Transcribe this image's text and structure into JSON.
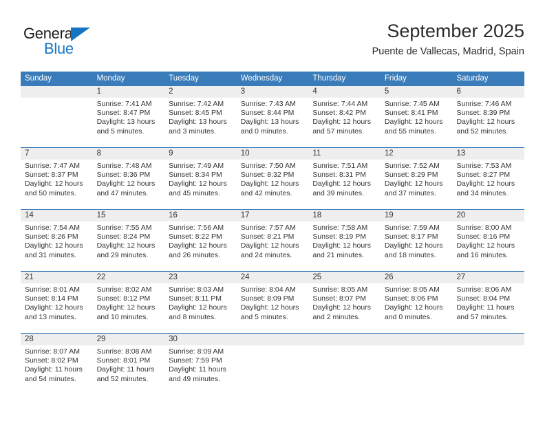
{
  "brand": {
    "name_part1": "General",
    "name_part2": "Blue",
    "triangle_icon": "triangle-icon",
    "accent_color": "#1676c4"
  },
  "header": {
    "title": "September 2025",
    "subtitle": "Puente de Vallecas, Madrid, Spain"
  },
  "calendar": {
    "header_bg_color": "#3a7cba",
    "day_band_color": "#eeeeee",
    "weekday_headers": [
      "Sunday",
      "Monday",
      "Tuesday",
      "Wednesday",
      "Thursday",
      "Friday",
      "Saturday"
    ],
    "weeks": [
      [
        {
          "day": "",
          "sunrise": "",
          "sunset": "",
          "daylight_line1": "",
          "daylight_line2": ""
        },
        {
          "day": "1",
          "sunrise": "Sunrise: 7:41 AM",
          "sunset": "Sunset: 8:47 PM",
          "daylight_line1": "Daylight: 13 hours",
          "daylight_line2": "and 5 minutes."
        },
        {
          "day": "2",
          "sunrise": "Sunrise: 7:42 AM",
          "sunset": "Sunset: 8:45 PM",
          "daylight_line1": "Daylight: 13 hours",
          "daylight_line2": "and 3 minutes."
        },
        {
          "day": "3",
          "sunrise": "Sunrise: 7:43 AM",
          "sunset": "Sunset: 8:44 PM",
          "daylight_line1": "Daylight: 13 hours",
          "daylight_line2": "and 0 minutes."
        },
        {
          "day": "4",
          "sunrise": "Sunrise: 7:44 AM",
          "sunset": "Sunset: 8:42 PM",
          "daylight_line1": "Daylight: 12 hours",
          "daylight_line2": "and 57 minutes."
        },
        {
          "day": "5",
          "sunrise": "Sunrise: 7:45 AM",
          "sunset": "Sunset: 8:41 PM",
          "daylight_line1": "Daylight: 12 hours",
          "daylight_line2": "and 55 minutes."
        },
        {
          "day": "6",
          "sunrise": "Sunrise: 7:46 AM",
          "sunset": "Sunset: 8:39 PM",
          "daylight_line1": "Daylight: 12 hours",
          "daylight_line2": "and 52 minutes."
        }
      ],
      [
        {
          "day": "7",
          "sunrise": "Sunrise: 7:47 AM",
          "sunset": "Sunset: 8:37 PM",
          "daylight_line1": "Daylight: 12 hours",
          "daylight_line2": "and 50 minutes."
        },
        {
          "day": "8",
          "sunrise": "Sunrise: 7:48 AM",
          "sunset": "Sunset: 8:36 PM",
          "daylight_line1": "Daylight: 12 hours",
          "daylight_line2": "and 47 minutes."
        },
        {
          "day": "9",
          "sunrise": "Sunrise: 7:49 AM",
          "sunset": "Sunset: 8:34 PM",
          "daylight_line1": "Daylight: 12 hours",
          "daylight_line2": "and 45 minutes."
        },
        {
          "day": "10",
          "sunrise": "Sunrise: 7:50 AM",
          "sunset": "Sunset: 8:32 PM",
          "daylight_line1": "Daylight: 12 hours",
          "daylight_line2": "and 42 minutes."
        },
        {
          "day": "11",
          "sunrise": "Sunrise: 7:51 AM",
          "sunset": "Sunset: 8:31 PM",
          "daylight_line1": "Daylight: 12 hours",
          "daylight_line2": "and 39 minutes."
        },
        {
          "day": "12",
          "sunrise": "Sunrise: 7:52 AM",
          "sunset": "Sunset: 8:29 PM",
          "daylight_line1": "Daylight: 12 hours",
          "daylight_line2": "and 37 minutes."
        },
        {
          "day": "13",
          "sunrise": "Sunrise: 7:53 AM",
          "sunset": "Sunset: 8:27 PM",
          "daylight_line1": "Daylight: 12 hours",
          "daylight_line2": "and 34 minutes."
        }
      ],
      [
        {
          "day": "14",
          "sunrise": "Sunrise: 7:54 AM",
          "sunset": "Sunset: 8:26 PM",
          "daylight_line1": "Daylight: 12 hours",
          "daylight_line2": "and 31 minutes."
        },
        {
          "day": "15",
          "sunrise": "Sunrise: 7:55 AM",
          "sunset": "Sunset: 8:24 PM",
          "daylight_line1": "Daylight: 12 hours",
          "daylight_line2": "and 29 minutes."
        },
        {
          "day": "16",
          "sunrise": "Sunrise: 7:56 AM",
          "sunset": "Sunset: 8:22 PM",
          "daylight_line1": "Daylight: 12 hours",
          "daylight_line2": "and 26 minutes."
        },
        {
          "day": "17",
          "sunrise": "Sunrise: 7:57 AM",
          "sunset": "Sunset: 8:21 PM",
          "daylight_line1": "Daylight: 12 hours",
          "daylight_line2": "and 24 minutes."
        },
        {
          "day": "18",
          "sunrise": "Sunrise: 7:58 AM",
          "sunset": "Sunset: 8:19 PM",
          "daylight_line1": "Daylight: 12 hours",
          "daylight_line2": "and 21 minutes."
        },
        {
          "day": "19",
          "sunrise": "Sunrise: 7:59 AM",
          "sunset": "Sunset: 8:17 PM",
          "daylight_line1": "Daylight: 12 hours",
          "daylight_line2": "and 18 minutes."
        },
        {
          "day": "20",
          "sunrise": "Sunrise: 8:00 AM",
          "sunset": "Sunset: 8:16 PM",
          "daylight_line1": "Daylight: 12 hours",
          "daylight_line2": "and 16 minutes."
        }
      ],
      [
        {
          "day": "21",
          "sunrise": "Sunrise: 8:01 AM",
          "sunset": "Sunset: 8:14 PM",
          "daylight_line1": "Daylight: 12 hours",
          "daylight_line2": "and 13 minutes."
        },
        {
          "day": "22",
          "sunrise": "Sunrise: 8:02 AM",
          "sunset": "Sunset: 8:12 PM",
          "daylight_line1": "Daylight: 12 hours",
          "daylight_line2": "and 10 minutes."
        },
        {
          "day": "23",
          "sunrise": "Sunrise: 8:03 AM",
          "sunset": "Sunset: 8:11 PM",
          "daylight_line1": "Daylight: 12 hours",
          "daylight_line2": "and 8 minutes."
        },
        {
          "day": "24",
          "sunrise": "Sunrise: 8:04 AM",
          "sunset": "Sunset: 8:09 PM",
          "daylight_line1": "Daylight: 12 hours",
          "daylight_line2": "and 5 minutes."
        },
        {
          "day": "25",
          "sunrise": "Sunrise: 8:05 AM",
          "sunset": "Sunset: 8:07 PM",
          "daylight_line1": "Daylight: 12 hours",
          "daylight_line2": "and 2 minutes."
        },
        {
          "day": "26",
          "sunrise": "Sunrise: 8:05 AM",
          "sunset": "Sunset: 8:06 PM",
          "daylight_line1": "Daylight: 12 hours",
          "daylight_line2": "and 0 minutes."
        },
        {
          "day": "27",
          "sunrise": "Sunrise: 8:06 AM",
          "sunset": "Sunset: 8:04 PM",
          "daylight_line1": "Daylight: 11 hours",
          "daylight_line2": "and 57 minutes."
        }
      ],
      [
        {
          "day": "28",
          "sunrise": "Sunrise: 8:07 AM",
          "sunset": "Sunset: 8:02 PM",
          "daylight_line1": "Daylight: 11 hours",
          "daylight_line2": "and 54 minutes."
        },
        {
          "day": "29",
          "sunrise": "Sunrise: 8:08 AM",
          "sunset": "Sunset: 8:01 PM",
          "daylight_line1": "Daylight: 11 hours",
          "daylight_line2": "and 52 minutes."
        },
        {
          "day": "30",
          "sunrise": "Sunrise: 8:09 AM",
          "sunset": "Sunset: 7:59 PM",
          "daylight_line1": "Daylight: 11 hours",
          "daylight_line2": "and 49 minutes."
        },
        {
          "day": "",
          "sunrise": "",
          "sunset": "",
          "daylight_line1": "",
          "daylight_line2": ""
        },
        {
          "day": "",
          "sunrise": "",
          "sunset": "",
          "daylight_line1": "",
          "daylight_line2": ""
        },
        {
          "day": "",
          "sunrise": "",
          "sunset": "",
          "daylight_line1": "",
          "daylight_line2": ""
        },
        {
          "day": "",
          "sunrise": "",
          "sunset": "",
          "daylight_line1": "",
          "daylight_line2": ""
        }
      ]
    ]
  }
}
